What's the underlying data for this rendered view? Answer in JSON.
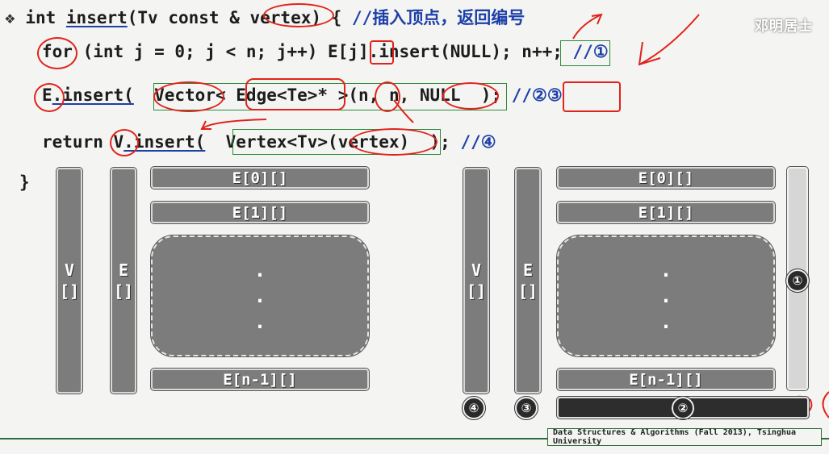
{
  "code": {
    "line1": {
      "bullet": "❖",
      "kw": "int",
      "fname": "insert",
      "args_a": "(Tv const &",
      "arg": "vertex",
      "args_b": ") {",
      "comment_slashes": "//",
      "comment_cn": "插入顶点，返回编号"
    },
    "line2": {
      "kw": "for",
      "a": "(int j = 0; j < n; j++) E[",
      "j": "j",
      "b": "].insert(NULL);",
      "incr": "n++;",
      "comment": "//①"
    },
    "line3": {
      "E": "E",
      "ins": ".insert(",
      "vector": "Vector<",
      "edge": "Edge<Te>*",
      "gt": ">(",
      "args": "n, n, NULL",
      "close": ");",
      "comment": "//②③"
    },
    "line4": {
      "ret": "return",
      "V": "V",
      "ins": ".insert(",
      "vert": "Vertex<Tv>(",
      "arg": "vertex)",
      "close": ");",
      "comment": "//④"
    },
    "brace": "}"
  },
  "diagram_left": {
    "v_label": [
      "V",
      "[]"
    ],
    "e_label": [
      "E",
      "[]"
    ],
    "row0": "E[0][]",
    "row1": "E[1][]",
    "dots": [
      ".",
      ".",
      "."
    ],
    "rowlast": "E[n-1][]"
  },
  "diagram_right": {
    "v_label": [
      "V",
      "[]"
    ],
    "e_label": [
      "E",
      "[]"
    ],
    "row0": "E[0][]",
    "row1": "E[1][]",
    "dots": [
      ".",
      ".",
      "."
    ],
    "rowlast": "E[n-1][]",
    "marker_new_col": "①",
    "marker_new_row": "②",
    "marker_e": "③",
    "marker_v": "④"
  },
  "footer": "Data Structures & Algorithms (Fall 2013), Tsinghua University",
  "watermark": "邓明居士",
  "colors": {
    "comment": "#1d3fa8",
    "box": "#2d8a3c",
    "annotation": "#e0231b",
    "bar": "#7c7c7c"
  }
}
